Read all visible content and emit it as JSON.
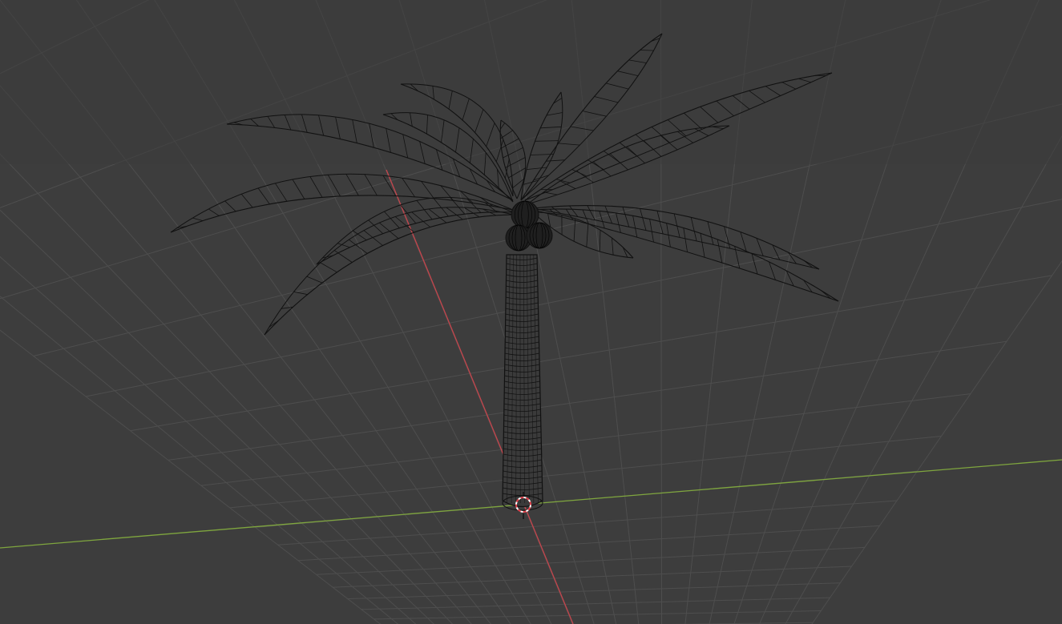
{
  "viewport": {
    "background": "#3d3d3d",
    "grid_color": "#4e4e4e",
    "x_axis_color": "#c4454c",
    "y_axis_color": "#7fa63e",
    "wire_color": "#111111",
    "cursor_colors": [
      "#ffffff",
      "#e2404a"
    ]
  },
  "scene": {
    "object": "palm-tree",
    "display_mode": "wireframe",
    "parts": [
      "trunk",
      "coconuts",
      "fronds"
    ],
    "frond_count": 14,
    "coconut_count": 3
  },
  "icons": {
    "cursor": "3d-cursor-icon"
  }
}
